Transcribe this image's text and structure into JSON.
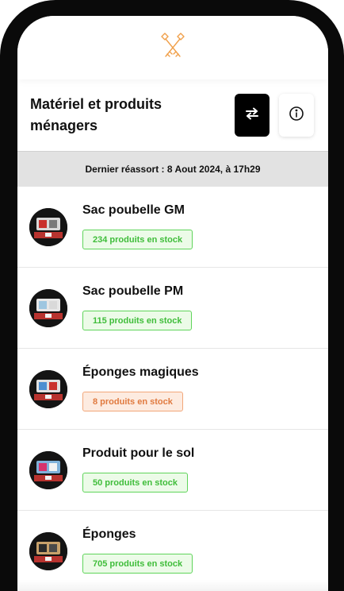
{
  "header": {
    "title": "Matériel et produits ménagers",
    "switch_icon": "swap-arrows-icon",
    "info_icon": "info-circle-icon"
  },
  "logo_icon": "crossed-keys-logo",
  "banner": {
    "text": "Dernier réassort : 8 Aout 2024, à 17h29"
  },
  "colors": {
    "accent": "#f0a04b",
    "stock_ok_text": "#3fbd3a",
    "stock_low_text": "#e07a3f"
  },
  "items": [
    {
      "name": "Sac poubelle GM",
      "stock": "234 produits en stock",
      "status": "ok"
    },
    {
      "name": "Sac poubelle PM",
      "stock": "115 produits en stock",
      "status": "ok"
    },
    {
      "name": "Éponges magiques",
      "stock": "8 produits en stock",
      "status": "low"
    },
    {
      "name": "Produit pour le sol",
      "stock": "50 produits en stock",
      "status": "ok"
    },
    {
      "name": "Éponges",
      "stock": "705 produits en stock",
      "status": "ok"
    }
  ]
}
